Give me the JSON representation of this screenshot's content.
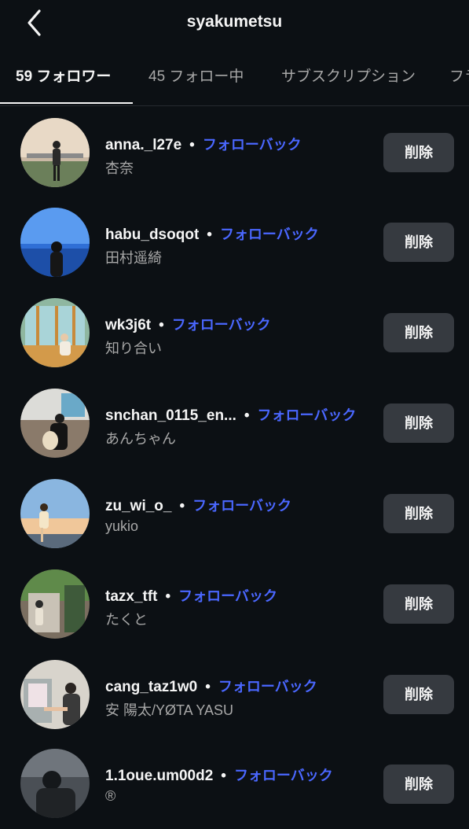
{
  "header": {
    "title": "syakumetsu",
    "back_icon": "chevron-left-icon"
  },
  "tabs": [
    {
      "label": "59 フォロワー",
      "active": true
    },
    {
      "label": "45 フォロー中",
      "active": false
    },
    {
      "label": "サブスクリプション",
      "active": false
    },
    {
      "label": "フラ",
      "active": false
    }
  ],
  "followers": [
    {
      "username": "anna._l27e",
      "separator": "•",
      "action": "フォローバック",
      "fullname": "杏奈",
      "remove": "削除"
    },
    {
      "username": "habu_dsoqot",
      "separator": "•",
      "action": "フォローバック",
      "fullname": "田村遥綺",
      "remove": "削除"
    },
    {
      "username": "wk3j6t",
      "separator": "•",
      "action": "フォローバック",
      "fullname": "知り合い",
      "remove": "削除"
    },
    {
      "username": "snchan_0115_en...",
      "separator": "•",
      "action": "フォローバック",
      "fullname": "あんちゃん",
      "remove": "削除"
    },
    {
      "username": "zu_wi_o_",
      "separator": "•",
      "action": "フォローバック",
      "fullname": "yukio",
      "remove": "削除"
    },
    {
      "username": "tazx_tft",
      "separator": "•",
      "action": "フォローバック",
      "fullname": "たくと",
      "remove": "削除"
    },
    {
      "username": "cang_taz1w0",
      "separator": "•",
      "action": "フォローバック",
      "fullname": "安 陽太/YØTA YASU",
      "remove": "削除"
    },
    {
      "username": "1.1oue.um00d2",
      "separator": "•",
      "action": "フォローバック",
      "fullname": "®",
      "remove": "削除"
    }
  ],
  "colors": {
    "background": "#0c1014",
    "link": "#4a67ff",
    "button": "#363a40",
    "muted": "#a8a8a8"
  }
}
